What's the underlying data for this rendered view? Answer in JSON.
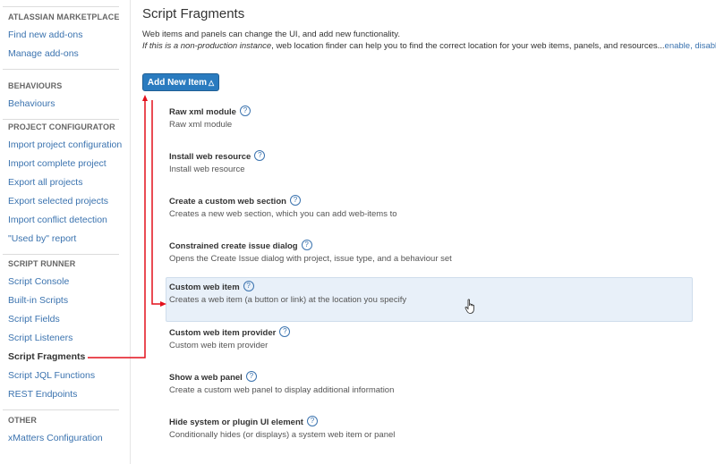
{
  "sidebar": {
    "sections": [
      {
        "heading": "ATLASSIAN MARKETPLACE",
        "items": [
          "Find new add-ons",
          "Manage add-ons"
        ]
      },
      {
        "heading": "BEHAVIOURS",
        "items": [
          "Behaviours"
        ]
      },
      {
        "heading": "PROJECT CONFIGURATOR",
        "items": [
          "Import project configuration",
          "Import complete project",
          "Export all projects",
          "Export selected projects",
          "Import conflict detection",
          "\"Used by\" report"
        ]
      },
      {
        "heading": "SCRIPT RUNNER",
        "items": [
          "Script Console",
          "Built-in Scripts",
          "Script Fields",
          "Script Listeners",
          "Script Fragments",
          "Script JQL Functions",
          "REST Endpoints"
        ]
      },
      {
        "heading": "OTHER",
        "items": [
          "xMatters Configuration"
        ]
      }
    ],
    "active_item": "Script Fragments"
  },
  "main": {
    "title": "Script Fragments",
    "description_line1": "Web items and panels can change the UI, and add new functionality.",
    "description_line2_italic": "If this is a non-production instance",
    "description_line2_rest": ", web location finder can help you to find the correct location for your web items, panels, and resources...",
    "enable_link": "enable",
    "separator": ", ",
    "disable_link": "disable",
    "period": ".",
    "add_button_label": "Add New Item",
    "add_button_icon": "chevron-double-up-icon",
    "items": [
      {
        "title": "Raw xml module",
        "description": "Raw xml module"
      },
      {
        "title": "Install web resource",
        "description": "Install web resource"
      },
      {
        "title": "Create a custom web section",
        "description": "Creates a new web section, which you can add web-items to"
      },
      {
        "title": "Constrained create issue dialog",
        "description": "Opens the Create Issue dialog with project, issue type, and a behaviour set"
      },
      {
        "title": "Custom web item",
        "description": "Creates a web item (a button or link) at the location you specify",
        "hovered": true
      },
      {
        "title": "Custom web item provider",
        "description": "Custom web item provider"
      },
      {
        "title": "Show a web panel",
        "description": "Create a custom web panel to display additional information"
      },
      {
        "title": "Hide system or plugin UI element",
        "description": "Conditionally hides (or displays) a system web item or panel"
      }
    ],
    "help_icon_glyph": "?"
  },
  "colors": {
    "link": "#3b73af",
    "button": "#2a7bbf",
    "hover_row": "#e8f0f9",
    "annotation": "#e3101c"
  }
}
